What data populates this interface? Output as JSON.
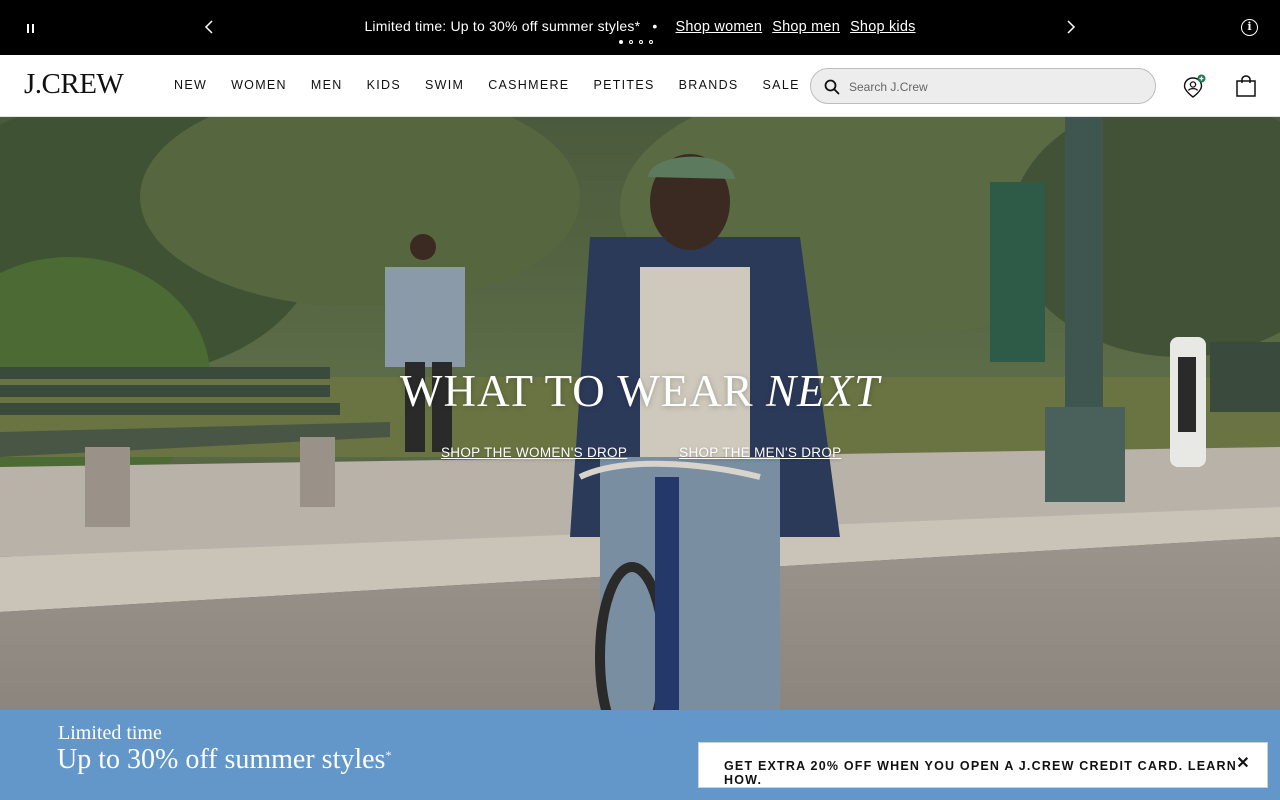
{
  "promo": {
    "message": "Limited time: Up to 30% off summer styles*",
    "separator": "•",
    "links": [
      "Shop women",
      "Shop men",
      "Shop kids"
    ],
    "pause_icon": "pause-icon",
    "prev_icon": "chevron-left-icon",
    "next_icon": "chevron-right-icon",
    "info_icon": "info-icon",
    "info_glyph": "i"
  },
  "header": {
    "logo": "J.CREW",
    "nav": [
      "NEW",
      "WOMEN",
      "MEN",
      "KIDS",
      "SWIM",
      "CASHMERE",
      "PETITES",
      "BRANDS",
      "SALE"
    ],
    "search_placeholder": "Search J.Crew",
    "account_icon": "account-icon",
    "bag_icon": "shopping-bag-icon"
  },
  "hero": {
    "title_main": "WHAT TO WEAR ",
    "title_emphasis": "NEXT",
    "link_women": "SHOP THE WOMEN'S DROP",
    "link_men": "SHOP THE MEN'S DROP"
  },
  "bottom_banner": {
    "small": "Limited time",
    "large": "Up to 30% off summer styles",
    "mark": "*"
  },
  "credit_card": {
    "text": "GET EXTRA 20% OFF WHEN YOU OPEN A J.CREW CREDIT CARD. LEARN HOW.",
    "close": "✕"
  },
  "colors": {
    "promo_bg": "#000000",
    "banner_blue": "#6396c9",
    "account_badge": "#1e7a4e"
  }
}
